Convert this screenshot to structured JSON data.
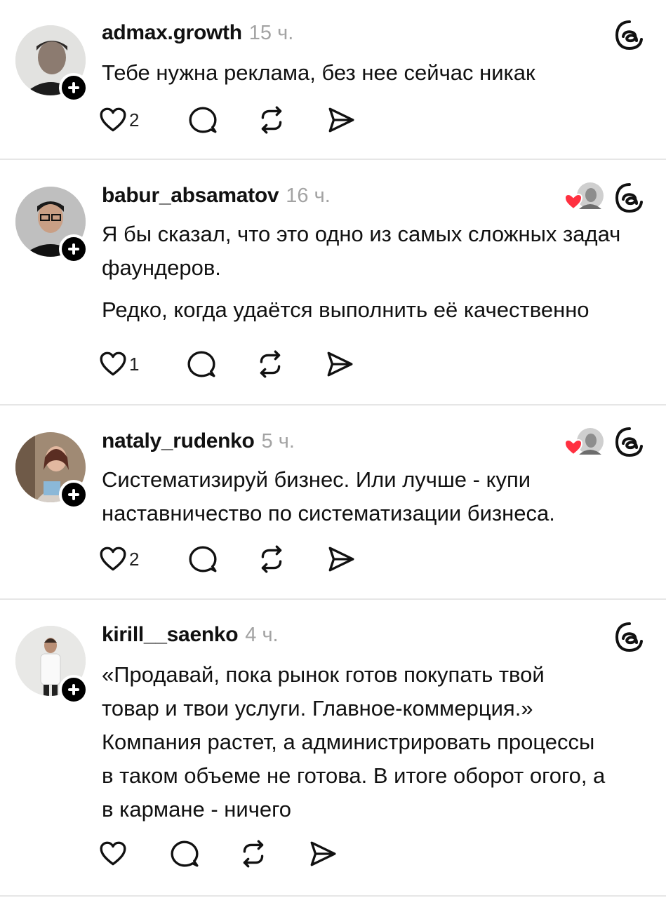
{
  "posts": [
    {
      "username": "admax.growth",
      "time": "15 ч.",
      "paragraphs": [
        "Тебе нужна реклама, без нее сейчас никак"
      ],
      "likes": "2",
      "liked_by_author": false
    },
    {
      "username": "babur_absamatov",
      "time": "16 ч.",
      "paragraphs": [
        "Я бы сказал, что это одно из самых сложных задач фаундеров.",
        "Редко, когда удаётся выполнить её качественно"
      ],
      "likes": "1",
      "liked_by_author": true
    },
    {
      "username": "nataly_rudenko",
      "time": "5 ч.",
      "paragraphs": [
        "Систематизируй бизнес. Или лучше - купи наставничество по систематизации бизнеса."
      ],
      "likes": "2",
      "liked_by_author": true
    },
    {
      "username": "kirill__saenko",
      "time": "4 ч.",
      "paragraphs": [
        "«Продавай, пока рынок готов покупать твой товар и твои услуги. Главное-коммерция.»",
        "Компания растет, а администрировать процессы в таком объеме не готова. В итоге оборот огого, а в кармане - ничего"
      ],
      "likes": "",
      "liked_by_author": false
    }
  ],
  "icons": {
    "like": "heart-outline-icon",
    "reply": "speech-bubble-icon",
    "repost": "repost-arrows-icon",
    "share": "paper-plane-icon",
    "threads": "threads-logo-icon",
    "follow": "plus-icon"
  },
  "colors": {
    "text": "#111111",
    "timestamp": "#a3a3a3",
    "divider": "#e6e6e6",
    "like_heart": "#ff3040"
  }
}
